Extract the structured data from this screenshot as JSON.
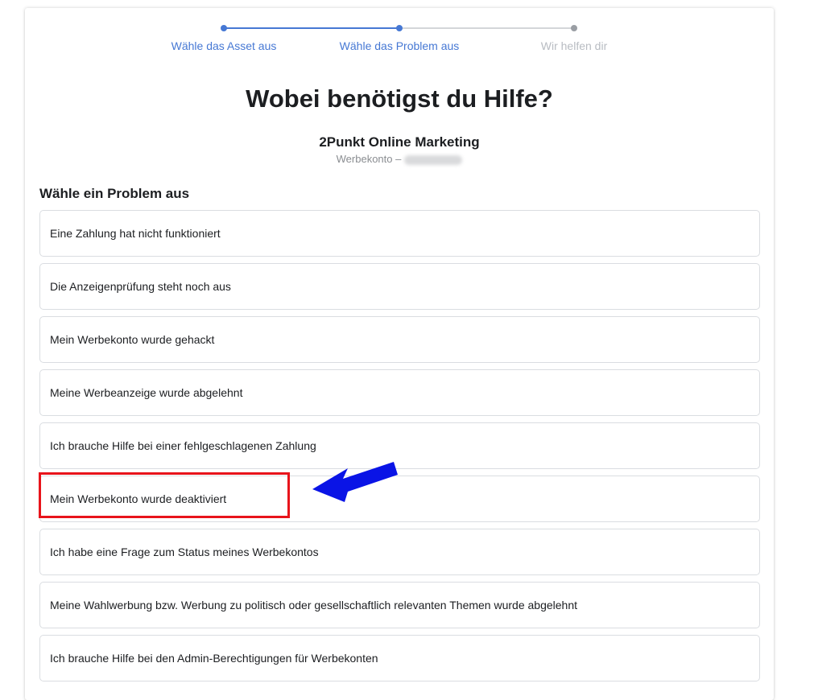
{
  "stepper": {
    "steps": [
      {
        "label": "Wähle das Asset aus",
        "state": "done"
      },
      {
        "label": "Wähle das Problem aus",
        "state": "active"
      },
      {
        "label": "Wir helfen dir",
        "state": "pending"
      }
    ],
    "colors": {
      "active": "#4678d4",
      "pending": "#b8bcc2"
    }
  },
  "page": {
    "title": "Wobei benötigst du Hilfe?"
  },
  "asset": {
    "name": "2Punkt Online Marketing",
    "subtitle": "Werbekonto –"
  },
  "problems": {
    "heading": "Wähle ein Problem aus",
    "items": [
      "Eine Zahlung hat nicht funktioniert",
      "Die Anzeigenprüfung steht noch aus",
      "Mein Werbekonto wurde gehackt",
      "Meine Werbeanzeige wurde abgelehnt",
      "Ich brauche Hilfe bei einer fehlgeschlagenen Zahlung",
      "Mein Werbekonto wurde deaktiviert",
      "Ich habe eine Frage zum Status meines Werbekontos",
      "Meine Wahlwerbung bzw. Werbung zu politisch oder gesellschaftlich relevanten Themen wurde abgelehnt",
      "Ich brauche Hilfe bei den Admin-Berechtigungen für Werbekonten"
    ]
  },
  "annotations": {
    "highlight_color": "#e8141b",
    "arrow_color": "#0a14e6"
  }
}
